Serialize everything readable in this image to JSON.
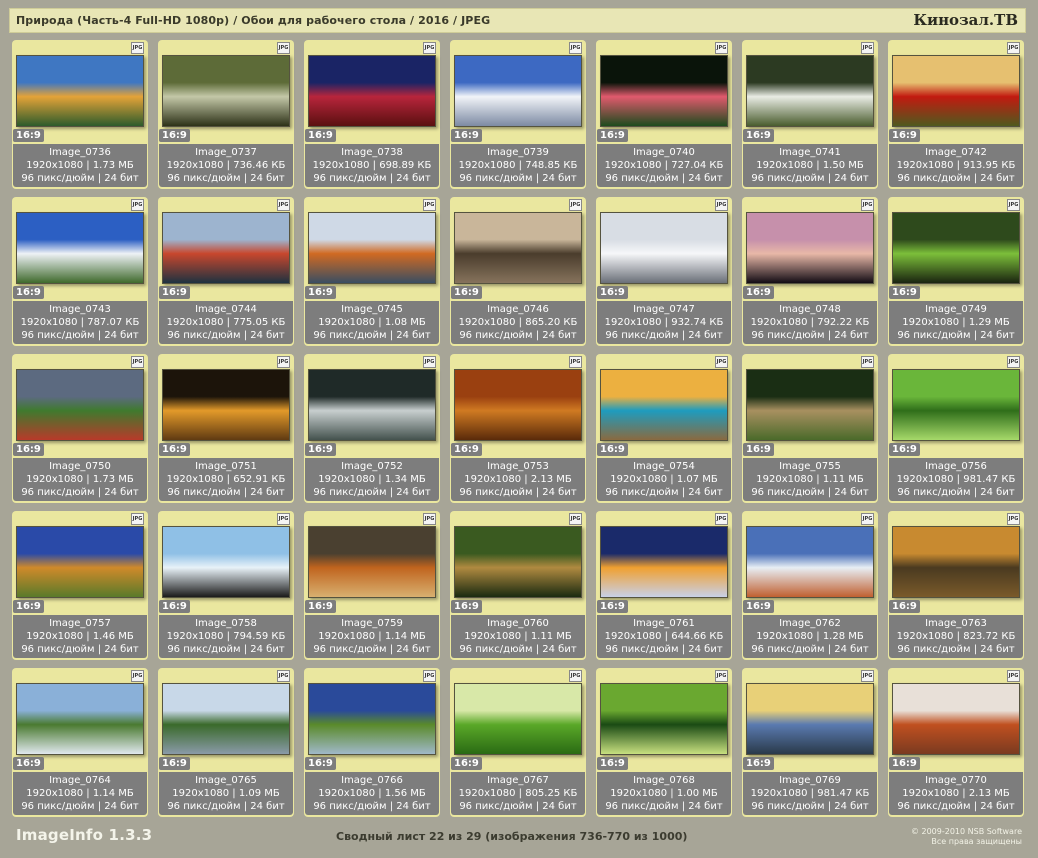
{
  "header": {
    "title": "Природа (Часть-4 Full-HD 1080p) / Обои для рабочего стола / 2016 / JPEG",
    "brand": "Кинозал.ТВ"
  },
  "images": [
    {
      "name": "Image_0736",
      "res": "1920x1080",
      "size": "1.73 МБ",
      "dpi": "96 пикс/дюйм",
      "bits": "24 бит",
      "ratio": "16:9",
      "badge": "JPG",
      "scene": "autumn-river",
      "colors": [
        "#3f77c2",
        "#e4a338",
        "#2d5b2c"
      ]
    },
    {
      "name": "Image_0737",
      "res": "1920x1080",
      "size": "736.46 КБ",
      "dpi": "96 пикс/дюйм",
      "bits": "24 бит",
      "ratio": "16:9",
      "badge": "JPG",
      "scene": "spider-web",
      "colors": [
        "#5d6b38",
        "#c4c8a8",
        "#2d3218"
      ]
    },
    {
      "name": "Image_0738",
      "res": "1920x1080",
      "size": "698.89 КБ",
      "dpi": "96 пикс/дюйм",
      "bits": "24 бит",
      "ratio": "16:9",
      "badge": "JPG",
      "scene": "red-sunset",
      "colors": [
        "#1a2465",
        "#b8253c",
        "#5a1010"
      ]
    },
    {
      "name": "Image_0739",
      "res": "1920x1080",
      "size": "748.85 КБ",
      "dpi": "96 пикс/дюйм",
      "bits": "24 бит",
      "ratio": "16:9",
      "badge": "JPG",
      "scene": "snow-mountain",
      "colors": [
        "#3d69c2",
        "#f1f4f8",
        "#7d8aa3"
      ]
    },
    {
      "name": "Image_0740",
      "res": "1920x1080",
      "size": "727.04 КБ",
      "dpi": "96 пикс/дюйм",
      "bits": "24 бит",
      "ratio": "16:9",
      "badge": "JPG",
      "scene": "flower",
      "colors": [
        "#0a140a",
        "#e15a6d",
        "#1d4b1d"
      ]
    },
    {
      "name": "Image_0741",
      "res": "1920x1080",
      "size": "1.50 МБ",
      "dpi": "96 пикс/дюйм",
      "bits": "24 бит",
      "ratio": "16:9",
      "badge": "JPG",
      "scene": "waterfall",
      "colors": [
        "#2c3a22",
        "#e9ece4",
        "#4a5d2e"
      ]
    },
    {
      "name": "Image_0742",
      "res": "1920x1080",
      "size": "913.95 КБ",
      "dpi": "96 пикс/дюйм",
      "bits": "24 бит",
      "ratio": "16:9",
      "badge": "JPG",
      "scene": "poppies",
      "colors": [
        "#e6c070",
        "#c21a10",
        "#4f5a1e"
      ]
    },
    {
      "name": "Image_0743",
      "res": "1920x1080",
      "size": "787.07 КБ",
      "dpi": "96 пикс/дюйм",
      "bits": "24 бит",
      "ratio": "16:9",
      "badge": "JPG",
      "scene": "lake-sky",
      "colors": [
        "#2c5fc3",
        "#eef2f6",
        "#3f6a2c"
      ]
    },
    {
      "name": "Image_0744",
      "res": "1920x1080",
      "size": "775.05 КБ",
      "dpi": "96 пикс/дюйм",
      "bits": "24 бит",
      "ratio": "16:9",
      "badge": "JPG",
      "scene": "red-peak",
      "colors": [
        "#9db4cf",
        "#c8472d",
        "#1e3240"
      ]
    },
    {
      "name": "Image_0745",
      "res": "1920x1080",
      "size": "1.08 МБ",
      "dpi": "96 пикс/дюйм",
      "bits": "24 бит",
      "ratio": "16:9",
      "badge": "JPG",
      "scene": "autumn-lake",
      "colors": [
        "#cfd9e6",
        "#d16a22",
        "#3a4e62"
      ]
    },
    {
      "name": "Image_0746",
      "res": "1920x1080",
      "size": "865.20 КБ",
      "dpi": "96 пикс/дюйм",
      "bits": "24 бит",
      "ratio": "16:9",
      "badge": "JPG",
      "scene": "sepia-lake",
      "colors": [
        "#c9b69a",
        "#4a3c2c",
        "#86735c"
      ]
    },
    {
      "name": "Image_0747",
      "res": "1920x1080",
      "size": "932.74 КБ",
      "dpi": "96 пикс/дюйм",
      "bits": "24 бит",
      "ratio": "16:9",
      "badge": "JPG",
      "scene": "winter-fence",
      "colors": [
        "#d8dde4",
        "#f6f7f9",
        "#6a6f78"
      ]
    },
    {
      "name": "Image_0748",
      "res": "1920x1080",
      "size": "792.22 КБ",
      "dpi": "96 пикс/дюйм",
      "bits": "24 бит",
      "ratio": "16:9",
      "badge": "JPG",
      "scene": "palms",
      "colors": [
        "#c690ab",
        "#e8b8a8",
        "#120c14"
      ]
    },
    {
      "name": "Image_0749",
      "res": "1920x1080",
      "size": "1.29 МБ",
      "dpi": "96 пикс/дюйм",
      "bits": "24 бит",
      "ratio": "16:9",
      "badge": "JPG",
      "scene": "forest-green",
      "colors": [
        "#2e4a1c",
        "#7cbf3a",
        "#1a2410"
      ]
    },
    {
      "name": "Image_0750",
      "res": "1920x1080",
      "size": "1.73 МБ",
      "dpi": "96 пикс/дюйм",
      "bits": "24 бит",
      "ratio": "16:9",
      "badge": "JPG",
      "scene": "garden",
      "colors": [
        "#5c6a80",
        "#3f7a2e",
        "#b83a2a"
      ]
    },
    {
      "name": "Image_0751",
      "res": "1920x1080",
      "size": "652.91 КБ",
      "dpi": "96 пикс/дюйм",
      "bits": "24 бит",
      "ratio": "16:9",
      "badge": "JPG",
      "scene": "golden-lake",
      "colors": [
        "#1c140a",
        "#e39a2a",
        "#603a12"
      ]
    },
    {
      "name": "Image_0752",
      "res": "1920x1080",
      "size": "1.34 МБ",
      "dpi": "96 пикс/дюйм",
      "bits": "24 бит",
      "ratio": "16:9",
      "badge": "JPG",
      "scene": "dark-snow",
      "colors": [
        "#1f2a28",
        "#c8cfcf",
        "#44524e"
      ]
    },
    {
      "name": "Image_0753",
      "res": "1920x1080",
      "size": "2.13 МБ",
      "dpi": "96 пикс/дюйм",
      "bits": "24 бит",
      "ratio": "16:9",
      "badge": "JPG",
      "scene": "autumn-path",
      "colors": [
        "#9a4010",
        "#d07a22",
        "#5a2a0a"
      ]
    },
    {
      "name": "Image_0754",
      "res": "1920x1080",
      "size": "1.07 МБ",
      "dpi": "96 пикс/дюйм",
      "bits": "24 бит",
      "ratio": "16:9",
      "badge": "JPG",
      "scene": "sea-rocks",
      "colors": [
        "#ecb040",
        "#1e9cbf",
        "#8a6a40"
      ]
    },
    {
      "name": "Image_0755",
      "res": "1920x1080",
      "size": "1.11 МБ",
      "dpi": "96 пикс/дюйм",
      "bits": "24 бит",
      "ratio": "16:9",
      "badge": "JPG",
      "scene": "green-trail",
      "colors": [
        "#1a2e14",
        "#a89060",
        "#4a6a2a"
      ]
    },
    {
      "name": "Image_0756",
      "res": "1920x1080",
      "size": "981.47 КБ",
      "dpi": "96 пикс/дюйм",
      "bits": "24 бит",
      "ratio": "16:9",
      "badge": "JPG",
      "scene": "grass",
      "colors": [
        "#6ab63a",
        "#2f6e1a",
        "#a6d96a"
      ]
    },
    {
      "name": "Image_0757",
      "res": "1920x1080",
      "size": "1.46 МБ",
      "dpi": "96 пикс/дюйм",
      "bits": "24 бит",
      "ratio": "16:9",
      "badge": "JPG",
      "scene": "tree-field",
      "colors": [
        "#2a4aa8",
        "#d08a2a",
        "#5a7a2a"
      ]
    },
    {
      "name": "Image_0758",
      "res": "1920x1080",
      "size": "794.59 КБ",
      "dpi": "96 пикс/дюйм",
      "bits": "24 бит",
      "ratio": "16:9",
      "badge": "JPG",
      "scene": "leaning-tree",
      "colors": [
        "#8fc0e6",
        "#e8f2f8",
        "#1a1a1a"
      ]
    },
    {
      "name": "Image_0759",
      "res": "1920x1080",
      "size": "1.14 МБ",
      "dpi": "96 пикс/дюйм",
      "bits": "24 бит",
      "ratio": "16:9",
      "badge": "JPG",
      "scene": "hay-bale",
      "colors": [
        "#4a4030",
        "#c0641e",
        "#d8b070"
      ]
    },
    {
      "name": "Image_0760",
      "res": "1920x1080",
      "size": "1.11 МБ",
      "dpi": "96 пикс/дюйм",
      "bits": "24 бит",
      "ratio": "16:9",
      "badge": "JPG",
      "scene": "forest-walk",
      "colors": [
        "#3a5a20",
        "#b08a40",
        "#1a2a10"
      ]
    },
    {
      "name": "Image_0761",
      "res": "1920x1080",
      "size": "644.66 КБ",
      "dpi": "96 пикс/дюйм",
      "bits": "24 бит",
      "ratio": "16:9",
      "badge": "JPG",
      "scene": "winter-dusk",
      "colors": [
        "#1a2a6a",
        "#f0a030",
        "#c8d0e8"
      ]
    },
    {
      "name": "Image_0762",
      "res": "1920x1080",
      "size": "1.28 МБ",
      "dpi": "96 пикс/дюйм",
      "bits": "24 бит",
      "ratio": "16:9",
      "badge": "JPG",
      "scene": "glacier",
      "colors": [
        "#4a70b8",
        "#e8eef4",
        "#c06030"
      ]
    },
    {
      "name": "Image_0763",
      "res": "1920x1080",
      "size": "823.72 КБ",
      "dpi": "96 пикс/дюйм",
      "bits": "24 бит",
      "ratio": "16:9",
      "badge": "JPG",
      "scene": "field-dusk",
      "colors": [
        "#c88a30",
        "#4a3a20",
        "#7a5a2a"
      ]
    },
    {
      "name": "Image_0764",
      "res": "1920x1080",
      "size": "1.14 МБ",
      "dpi": "96 пикс/дюйм",
      "bits": "24 бит",
      "ratio": "16:9",
      "badge": "JPG",
      "scene": "valley",
      "colors": [
        "#8ab0d8",
        "#4a7a30",
        "#e0e8ee"
      ]
    },
    {
      "name": "Image_0765",
      "res": "1920x1080",
      "size": "1.09 МБ",
      "dpi": "96 пикс/дюйм",
      "bits": "24 бит",
      "ratio": "16:9",
      "badge": "JPG",
      "scene": "alps",
      "colors": [
        "#c8d8e8",
        "#3a6a2a",
        "#8a9aa8"
      ]
    },
    {
      "name": "Image_0766",
      "res": "1920x1080",
      "size": "1.56 МБ",
      "dpi": "96 пикс/дюйм",
      "bits": "24 бит",
      "ratio": "16:9",
      "badge": "JPG",
      "scene": "barn-stream",
      "colors": [
        "#2a4a9a",
        "#5a8a2a",
        "#a0b8c8"
      ]
    },
    {
      "name": "Image_0767",
      "res": "1920x1080",
      "size": "805.25 КБ",
      "dpi": "96 пикс/дюйм",
      "bits": "24 бит",
      "ratio": "16:9",
      "badge": "JPG",
      "scene": "green-blur",
      "colors": [
        "#d8e8a8",
        "#5aa828",
        "#2a6a14"
      ]
    },
    {
      "name": "Image_0768",
      "res": "1920x1080",
      "size": "1.00 МБ",
      "dpi": "96 пикс/дюйм",
      "bits": "24 бит",
      "ratio": "16:9",
      "badge": "JPG",
      "scene": "leaves",
      "colors": [
        "#6aa830",
        "#1a4a14",
        "#c8e080"
      ]
    },
    {
      "name": "Image_0769",
      "res": "1920x1080",
      "size": "981.47 КБ",
      "dpi": "96 пикс/дюйм",
      "bits": "24 бит",
      "ratio": "16:9",
      "badge": "JPG",
      "scene": "bokeh",
      "colors": [
        "#e8d078",
        "#5a7ab0",
        "#2a3a4a"
      ]
    },
    {
      "name": "Image_0770",
      "res": "1920x1080",
      "size": "2.13 МБ",
      "dpi": "96 пикс/дюйм",
      "bits": "24 бит",
      "ratio": "16:9",
      "badge": "JPG",
      "scene": "winter-sun",
      "colors": [
        "#e8e0d8",
        "#c05020",
        "#7a3a20"
      ]
    }
  ],
  "footer": {
    "app": "ImageInfo 1.3.3",
    "summary": "Сводный лист 22 из 29 (изображения 736-770 из 1000)",
    "copyright": "© 2009-2010 NSB Software",
    "rights": "Все права защищены"
  }
}
